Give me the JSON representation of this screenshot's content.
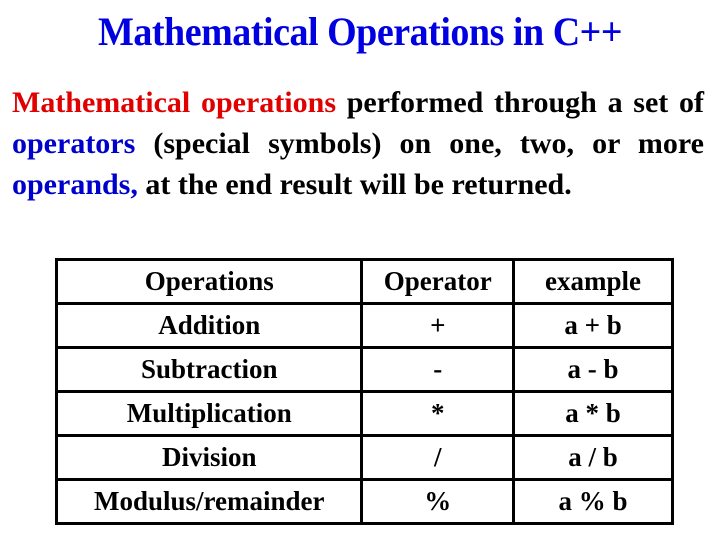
{
  "slide": {
    "title": "Mathematical Operations in C++",
    "paragraph": {
      "segments": [
        {
          "text": "Mathematical operations",
          "color": "red"
        },
        {
          "text": " performed through a set of ",
          "color": "black"
        },
        {
          "text": "operators",
          "color": "blue"
        },
        {
          "text": " (special symbols) on one, two, or more ",
          "color": "black"
        },
        {
          "text": "operands,",
          "color": "blue"
        },
        {
          "text": " at the end result will be returned.",
          "color": "black"
        }
      ]
    },
    "colors": {
      "title": "#0000e0",
      "highlight_red": "#e00000",
      "highlight_blue": "#0000cc",
      "text": "#000000"
    },
    "table": {
      "headers": [
        "Operations",
        "Operator",
        "example"
      ],
      "rows": [
        [
          "Addition",
          "+",
          "a + b"
        ],
        [
          "Subtraction",
          "-",
          "a - b"
        ],
        [
          "Multiplication",
          "*",
          "a * b"
        ],
        [
          "Division",
          "/",
          "a / b"
        ],
        [
          "Modulus/remainder",
          "%",
          "a % b"
        ]
      ]
    }
  }
}
